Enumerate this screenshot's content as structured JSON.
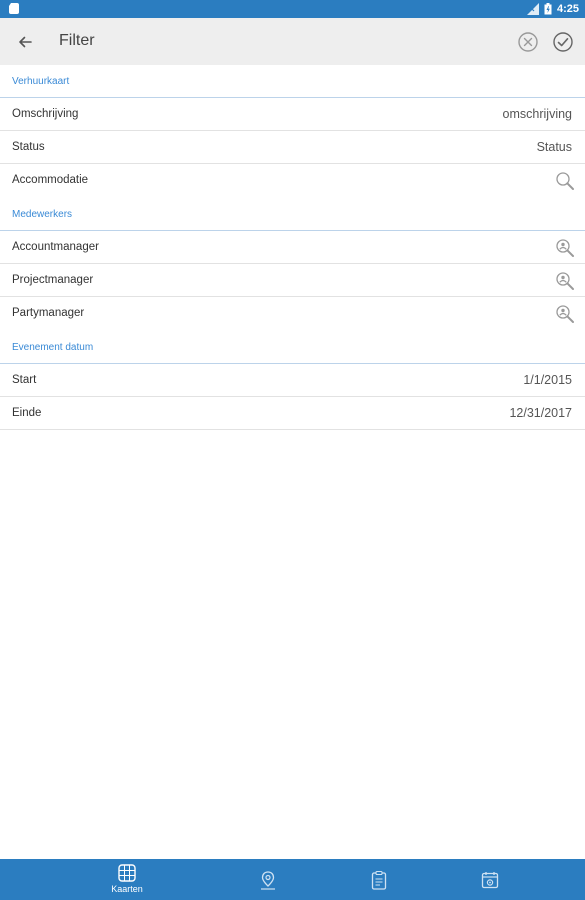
{
  "status_bar": {
    "time": "4:25",
    "icons": [
      "sim-card-icon",
      "signal-icon",
      "battery-icon"
    ]
  },
  "toolbar": {
    "title": "Filter",
    "icons": [
      "back-arrow-icon",
      "clear-circle-icon",
      "check-circle-icon"
    ]
  },
  "sections": {
    "verhuurkaart": {
      "header": "Verhuurkaart",
      "omschrijving": {
        "label": "Omschrijving",
        "placeholder": "omschrijving"
      },
      "status": {
        "label": "Status",
        "placeholder": "Status"
      },
      "accommodatie": {
        "label": "Accommodatie",
        "icon": "search-icon"
      }
    },
    "medewerkers": {
      "header": "Medewerkers",
      "accountmanager": {
        "label": "Accountmanager",
        "icon": "user-search-icon"
      },
      "projectmanager": {
        "label": "Projectmanager",
        "icon": "user-search-icon"
      },
      "partymanager": {
        "label": "Partymanager",
        "icon": "user-search-icon"
      }
    },
    "evenement_datum": {
      "header": "Evenement datum",
      "start": {
        "label": "Start",
        "value": "1/1/2015"
      },
      "einde": {
        "label": "Einde",
        "value": "12/31/2017"
      }
    }
  },
  "bottom_nav": {
    "items": [
      {
        "label": "Kaarten",
        "icon": "cards-grid-icon",
        "active": true
      },
      {
        "label": "",
        "icon": "map-pin-icon",
        "active": false
      },
      {
        "label": "",
        "icon": "clipboard-icon",
        "active": false
      },
      {
        "label": "",
        "icon": "calendar-settings-icon",
        "active": false
      }
    ]
  },
  "colors": {
    "primary": "#2b7dc0",
    "section_header_text": "#3a8ad6",
    "toolbar_bg": "#eeeeee",
    "divider": "#e2e2e2",
    "icon_gray": "#9a9a9a"
  }
}
